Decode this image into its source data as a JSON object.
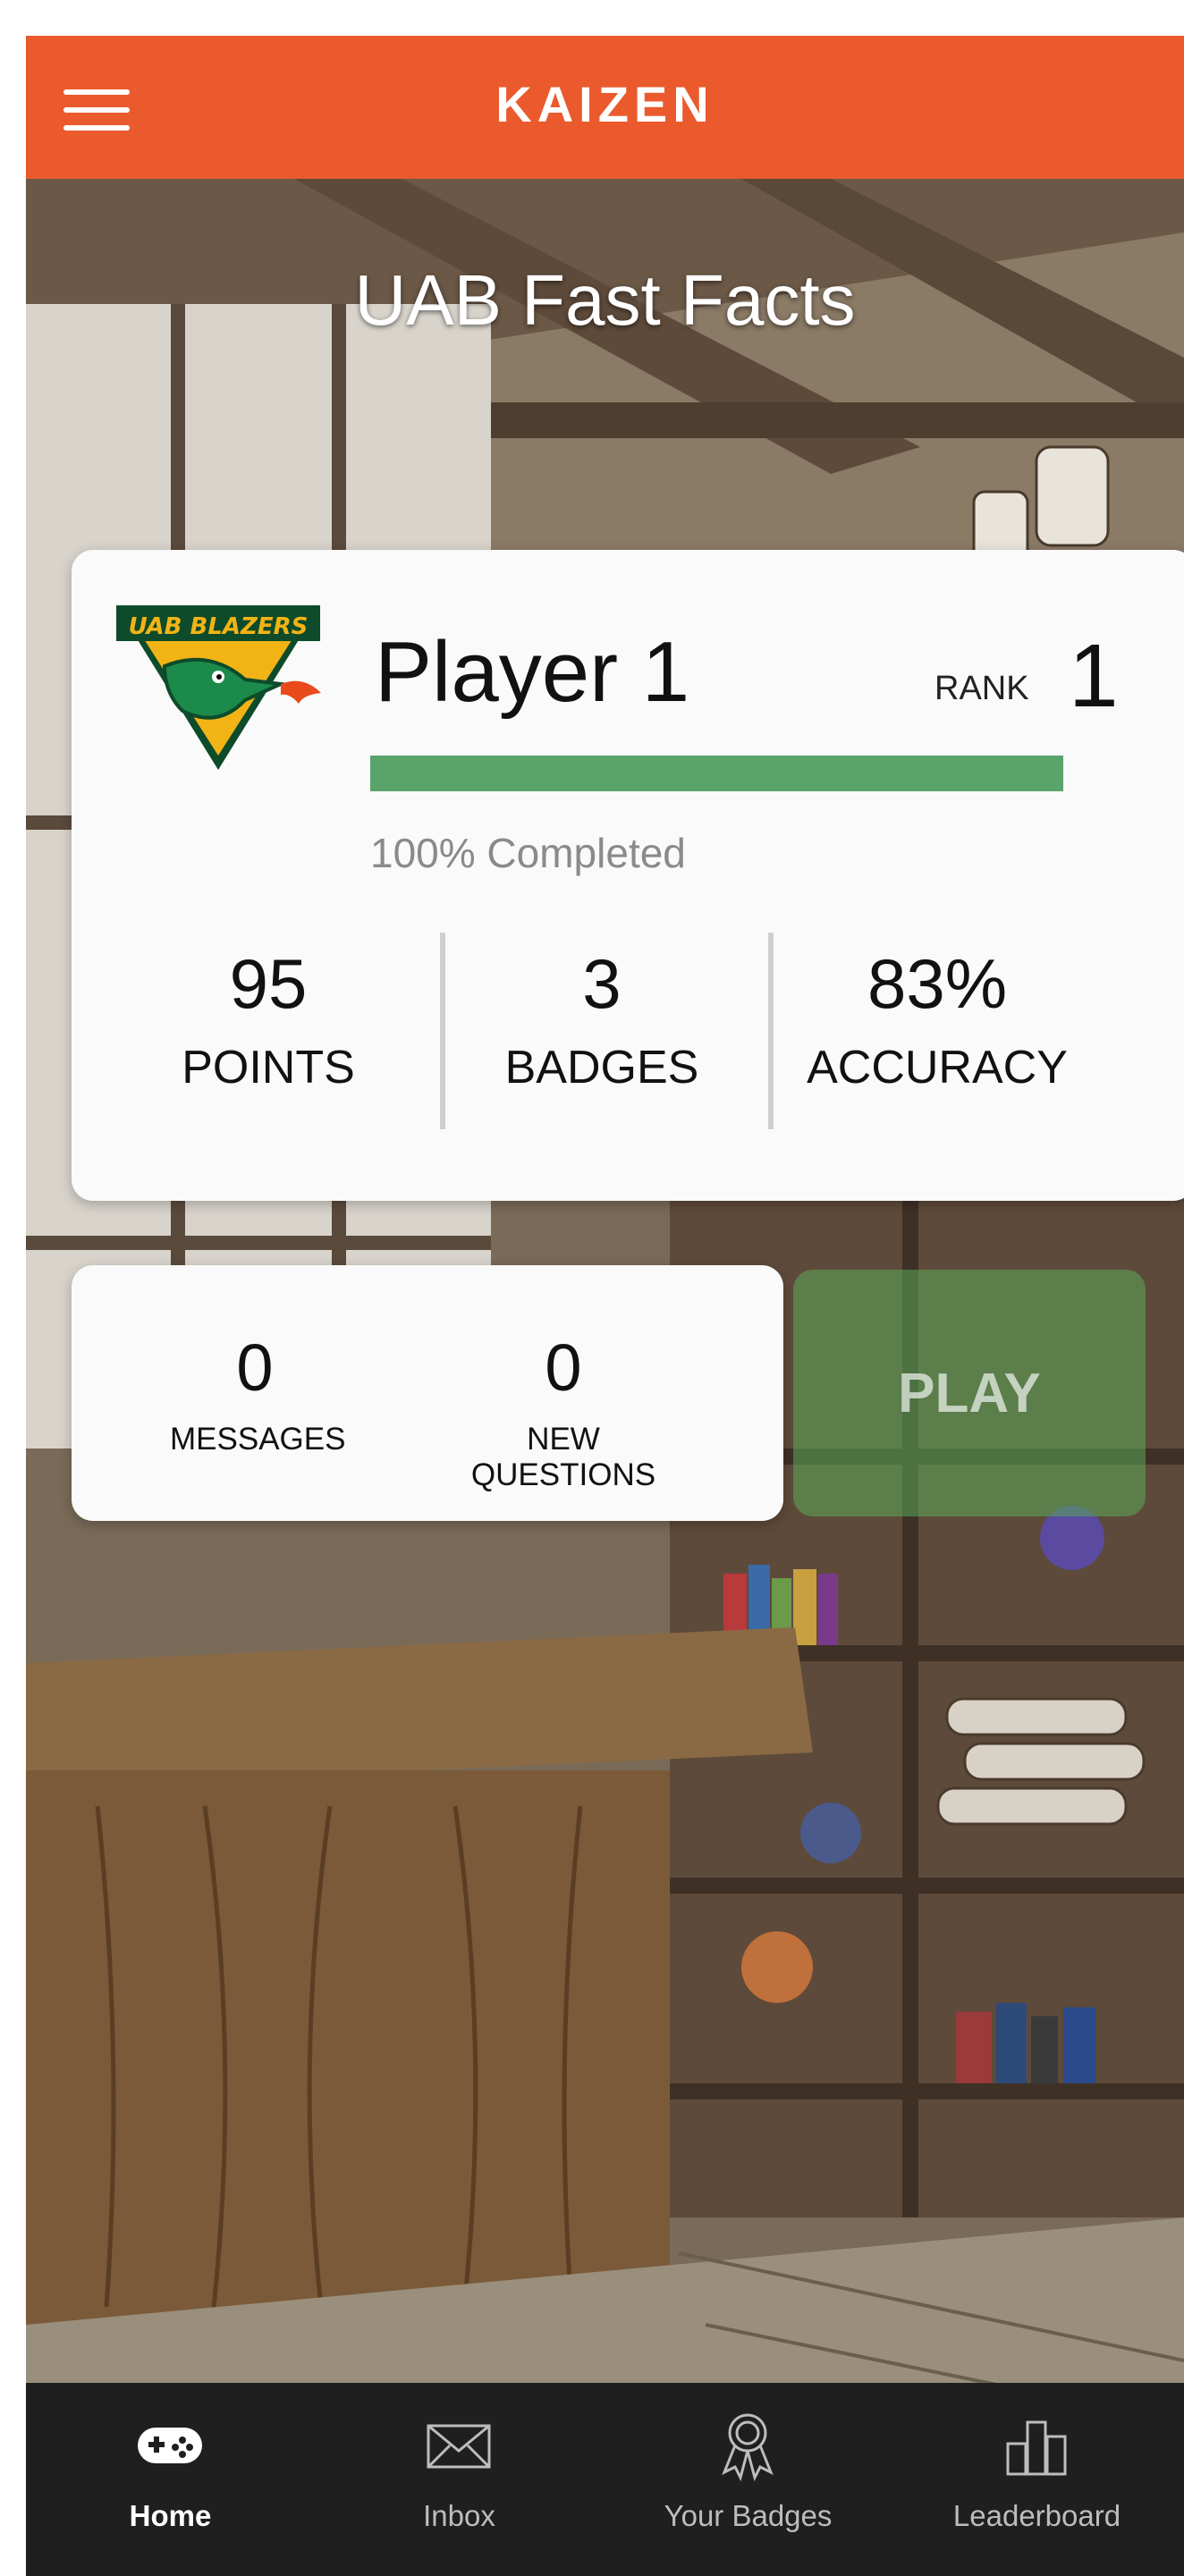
{
  "header": {
    "brand": "KAIZEN"
  },
  "game": {
    "title": "UAB Fast Facts"
  },
  "player": {
    "logo_text": "UAB BLAZERS",
    "name": "Player 1",
    "rank_label": "RANK",
    "rank": "1",
    "progress_percent": 100,
    "progress_text": "100% Completed",
    "stats": [
      {
        "value": "95",
        "label": "POINTS"
      },
      {
        "value": "3",
        "label": "BADGES"
      },
      {
        "value": "83%",
        "label": "ACCURACY"
      }
    ]
  },
  "inbox_summary": {
    "messages": {
      "value": "0",
      "label": "MESSAGES"
    },
    "new_questions": {
      "value": "0",
      "label": "NEW QUESTIONS"
    }
  },
  "play_button": {
    "label": "PLAY"
  },
  "nav": {
    "items": [
      {
        "label": "Home",
        "icon": "gamepad-icon",
        "active": true
      },
      {
        "label": "Inbox",
        "icon": "envelope-icon",
        "active": false
      },
      {
        "label": "Your Badges",
        "icon": "ribbon-badge-icon",
        "active": false
      },
      {
        "label": "Leaderboard",
        "icon": "bar-chart-icon",
        "active": false
      }
    ]
  },
  "colors": {
    "brand_orange": "#ea5a2c",
    "progress_green": "#5aa36a",
    "nav_background": "#1f1f1f"
  }
}
